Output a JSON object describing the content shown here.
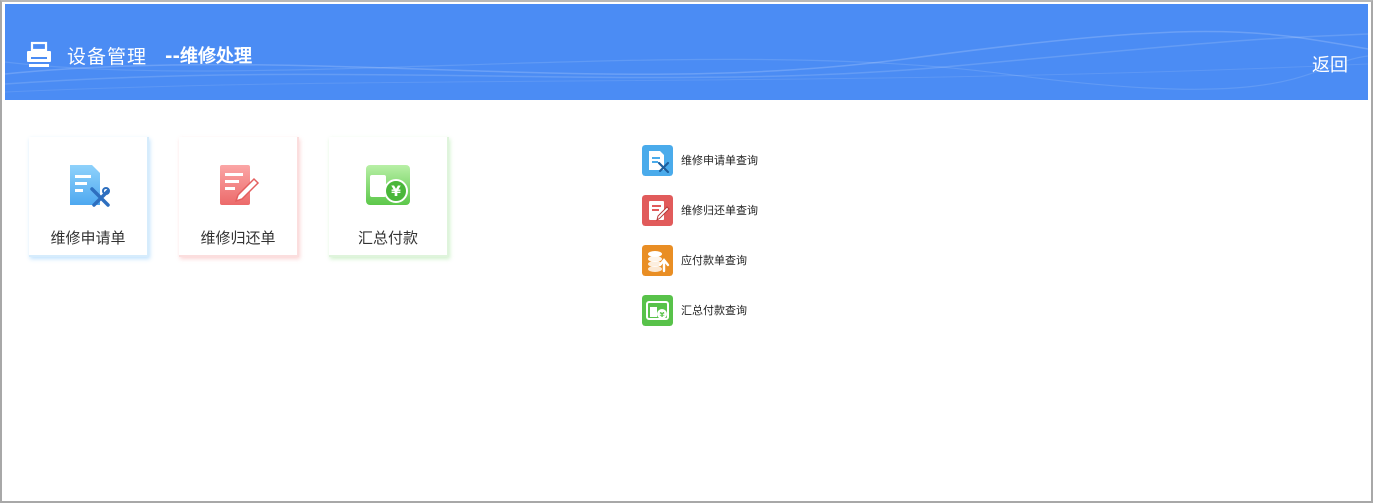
{
  "header": {
    "title": "设备管理",
    "subtitle": "--维修处理",
    "back_label": "返回",
    "title_icon": "printer-icon",
    "background_color": "#4b8cf4"
  },
  "tiles": [
    {
      "label": "维修申请单",
      "icon": "repair-request-icon",
      "color": "#5ab4f5"
    },
    {
      "label": "维修归还单",
      "icon": "edit-document-icon",
      "color": "#f07a7a"
    },
    {
      "label": "汇总付款",
      "icon": "wallet-yen-icon",
      "color": "#6fd35c"
    }
  ],
  "links": [
    {
      "label": "维修申请单查询",
      "icon": "repair-request-icon",
      "color": "#4aabeb"
    },
    {
      "label": "维修归还单查询",
      "icon": "edit-document-icon",
      "color": "#e15b5b"
    },
    {
      "label": "应付款单查询",
      "icon": "coins-upload-icon",
      "color": "#e98e24"
    },
    {
      "label": "汇总付款查询",
      "icon": "wallet-yen-icon",
      "color": "#58c24a"
    }
  ]
}
